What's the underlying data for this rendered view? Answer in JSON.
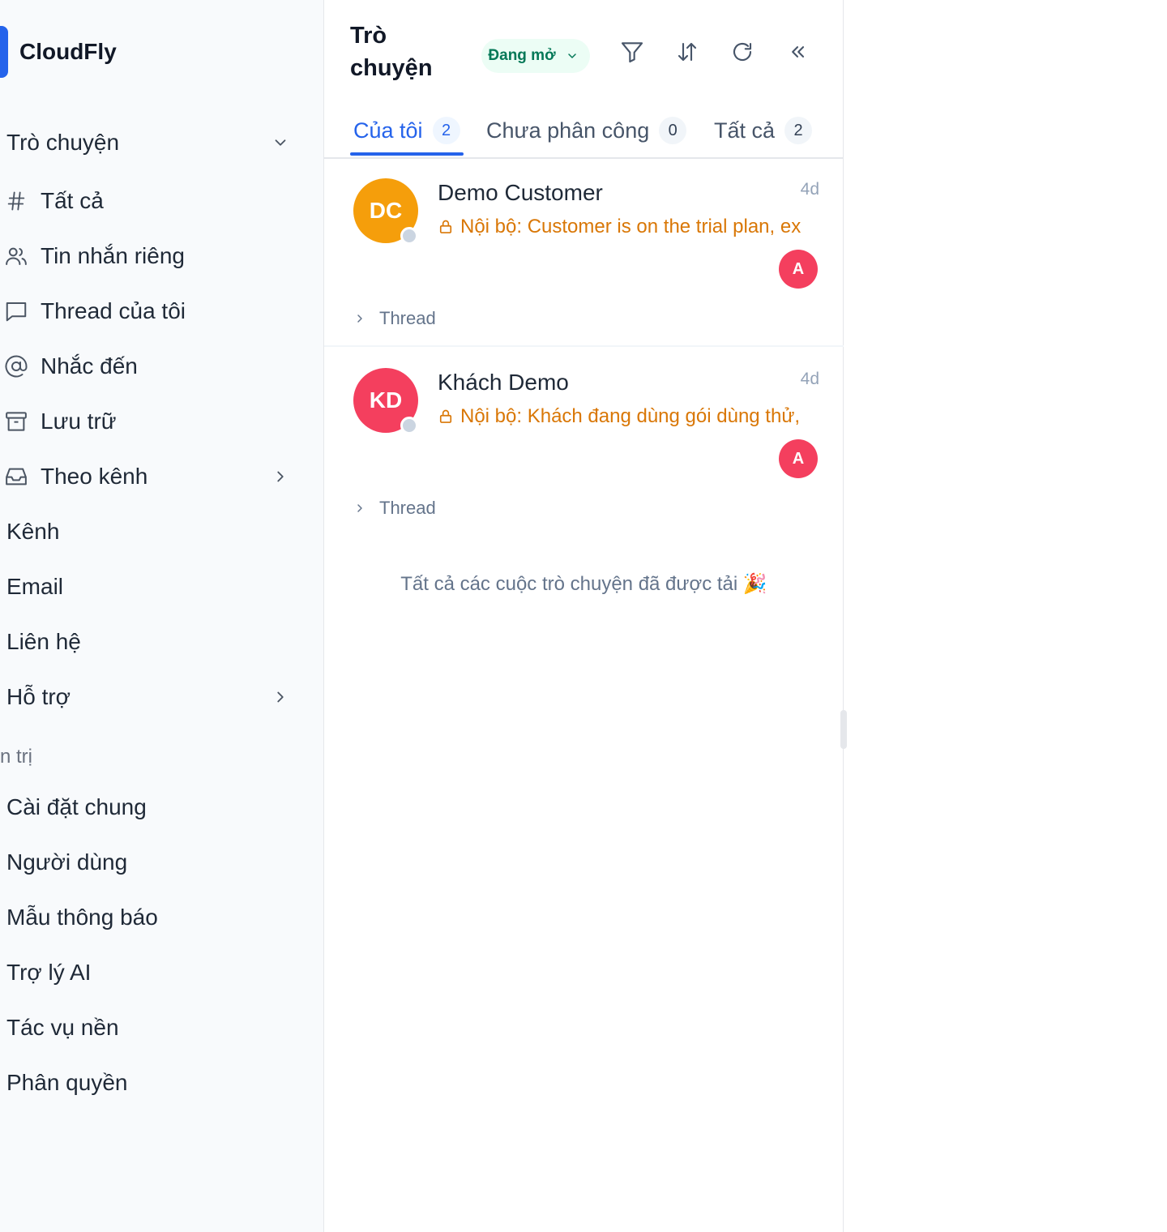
{
  "brand": {
    "name": "CloudFly",
    "accent": "#2563eb"
  },
  "sidebar": {
    "conversations_group": {
      "label": "Trò chuyện"
    },
    "items": [
      {
        "label": "Tất cả",
        "icon": "hash-icon"
      },
      {
        "label": "Tin nhắn riêng",
        "icon": "users-icon"
      },
      {
        "label": "Thread của tôi",
        "icon": "message-square-icon"
      },
      {
        "label": "Nhắc đến",
        "icon": "at-sign-icon"
      },
      {
        "label": "Lưu trữ",
        "icon": "archive-icon"
      },
      {
        "label": "Theo kênh",
        "icon": "inbox-icon"
      }
    ],
    "links": [
      {
        "label": "Kênh"
      },
      {
        "label": "Email"
      },
      {
        "label": "Liên hệ"
      },
      {
        "label": "Hỗ trợ"
      }
    ],
    "admin_section_label": "n trị",
    "admin_links": [
      {
        "label": "Cài đặt chung"
      },
      {
        "label": "Người dùng"
      },
      {
        "label": "Mẫu thông báo"
      },
      {
        "label": "Trợ lý AI"
      },
      {
        "label": "Tác vụ nền"
      },
      {
        "label": "Phân quyền"
      }
    ]
  },
  "panel": {
    "title": "Trò chuyện",
    "status_filter": "Đang mở",
    "tools": [
      "filter-icon",
      "sort-icon",
      "refresh-icon",
      "collapse-icon"
    ],
    "tabs": [
      {
        "label": "Của tôi",
        "count": "2",
        "active": true
      },
      {
        "label": "Chưa phân công",
        "count": "0",
        "active": false
      },
      {
        "label": "Tất cả",
        "count": "2",
        "active": false
      }
    ],
    "conversations": [
      {
        "initials": "DC",
        "avatar_color": "#f59e0b",
        "name": "Demo Customer",
        "time": "4d",
        "preview": "Nội bộ: Customer is on the trial plan, ex",
        "assignee": "A",
        "thread_label": "Thread"
      },
      {
        "initials": "KD",
        "avatar_color": "#f43f5e",
        "name": "Khách Demo",
        "time": "4d",
        "preview": "Nội bộ: Khách đang dùng gói dùng thử,",
        "assignee": "A",
        "thread_label": "Thread"
      }
    ],
    "end_note": "Tất cả các cuộc trò chuyện đã được tải 🎉"
  }
}
